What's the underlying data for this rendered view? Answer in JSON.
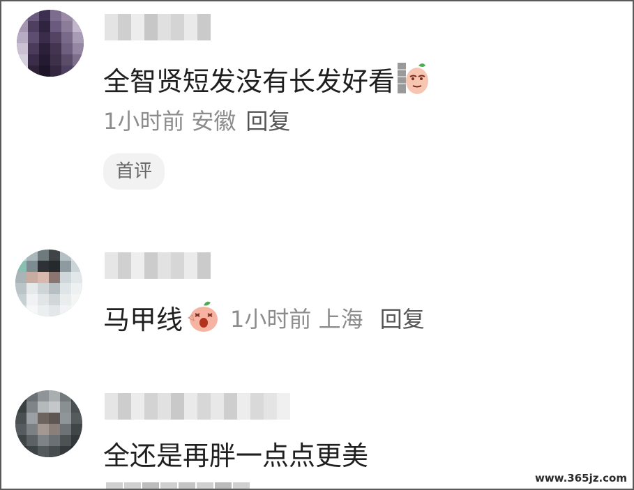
{
  "comments": [
    {
      "text": "全智贤短发没有长发好看",
      "time": "1小时前",
      "location": "安徽",
      "reply": "回复",
      "badge": "首评",
      "emoji": "peeking-face-emoji"
    },
    {
      "text": "马甲线",
      "time": "1小时前",
      "location": "上海",
      "reply": "回复",
      "emoji": "shocked-face-emoji"
    },
    {
      "text": "全还是再胖一点点更美"
    }
  ],
  "watermark": "www.365jz.com",
  "colors": {
    "meta_text": "#8c8c8c",
    "main_text": "#1f1f1f",
    "badge_bg": "#f2f2f2"
  }
}
